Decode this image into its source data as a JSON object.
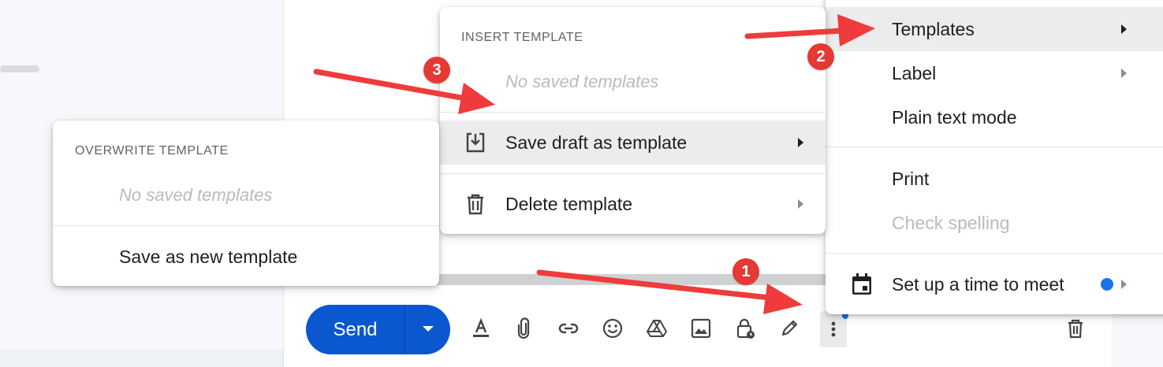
{
  "compose": {
    "send_label": "Send",
    "toolbar": [
      {
        "name": "format-text-icon",
        "glyph": "text-format"
      },
      {
        "name": "attach-icon",
        "glyph": "paperclip"
      },
      {
        "name": "insert-link-icon",
        "glyph": "link"
      },
      {
        "name": "emoji-icon",
        "glyph": "smiley"
      },
      {
        "name": "drive-icon",
        "glyph": "drive"
      },
      {
        "name": "insert-photo-icon",
        "glyph": "image"
      },
      {
        "name": "confidential-mode-icon",
        "glyph": "lock-clock"
      },
      {
        "name": "signature-icon",
        "glyph": "pen"
      },
      {
        "name": "more-options-icon",
        "glyph": "vertical-dots"
      },
      {
        "name": "discard-draft-icon",
        "glyph": "trash"
      }
    ]
  },
  "more_menu": {
    "items": [
      {
        "label": "Templates",
        "has_submenu": true,
        "highlighted": true
      },
      {
        "label": "Label",
        "has_submenu": true
      },
      {
        "label": "Plain text mode"
      },
      {
        "label": "Print"
      },
      {
        "label": "Check spelling",
        "disabled": true
      },
      {
        "label": "Set up a time to meet",
        "has_submenu": true,
        "badge_color": "#1a73e8"
      }
    ]
  },
  "templates_menu": {
    "header": "INSERT TEMPLATE",
    "empty_text": "No saved templates",
    "save_draft_label": "Save draft as template",
    "delete_label": "Delete template"
  },
  "save_submenu": {
    "header": "OVERWRITE TEMPLATE",
    "empty_text": "No saved templates",
    "save_new_label": "Save as new template"
  },
  "annotations": {
    "step1": "1",
    "step2": "2",
    "step3": "3",
    "arrow_color": "#ef3b3b"
  }
}
